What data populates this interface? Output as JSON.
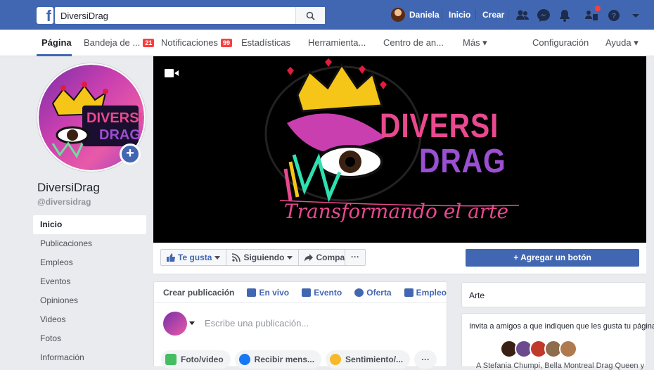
{
  "topbar": {
    "search_value": "DiversiDrag",
    "user_name": "Daniela",
    "home_label": "Inicio",
    "create_label": "Crear"
  },
  "tabs": [
    {
      "label": "Página",
      "badge": ""
    },
    {
      "label": "Bandeja de ...",
      "badge": "21"
    },
    {
      "label": "Notificaciones",
      "badge": "99"
    },
    {
      "label": "Estadísticas",
      "badge": ""
    },
    {
      "label": "Herramienta...",
      "badge": ""
    },
    {
      "label": "Centro de an...",
      "badge": ""
    },
    {
      "label": "Más ▾",
      "badge": ""
    },
    {
      "label": "Configuración",
      "badge": ""
    },
    {
      "label": "Ayuda ▾",
      "badge": ""
    }
  ],
  "page": {
    "name": "DiversiDrag",
    "handle": "@diversidrag"
  },
  "leftnav": [
    "Inicio",
    "Publicaciones",
    "Empleos",
    "Eventos",
    "Opiniones",
    "Videos",
    "Fotos",
    "Información"
  ],
  "cover": {
    "logo_line1": "DIVERSI",
    "logo_line2": "DRAG",
    "tagline": "Transformando el arte"
  },
  "actions": {
    "like": "Te gusta",
    "following": "Siguiendo",
    "share": "Compartir",
    "more": "···",
    "add_button": "+ Agregar un botón"
  },
  "composer": {
    "tabs": [
      "Crear publicación",
      "En vivo",
      "Evento",
      "Oferta",
      "Empleo"
    ],
    "placeholder": "Escribe una publicación...",
    "chips": [
      "Foto/video",
      "Recibir mens...",
      "Sentimiento/...",
      "···"
    ]
  },
  "sidebar": {
    "category": "Arte",
    "invite_title": "Invita a amigos a que indiquen que les gusta tu página",
    "invite_names": "A Stefania Chumpi, Bella Montreal Drag Queen y"
  },
  "colors": {
    "brand_blue": "#4267b2",
    "badge_red": "#fa3e3e",
    "cover_pink": "#e8498f",
    "cover_purple": "#9b4fd1"
  }
}
